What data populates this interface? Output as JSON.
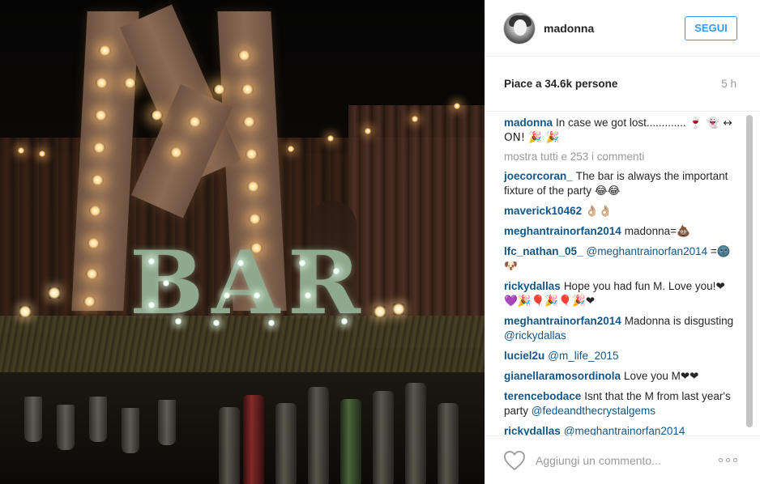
{
  "post": {
    "author": "madonna",
    "follow_label": "SEGUI",
    "likes_text": "Piace a 34.6k persone",
    "time_ago": "5 h",
    "caption": {
      "user": "madonna",
      "text": "In case we got lost.............",
      "emojis": "🍷 👻 ↔ ON! 🎉 🎉"
    },
    "show_all_comments": "mostra tutti e 253 i commenti",
    "comments": [
      {
        "user": "joecorcoran_",
        "pre": "The bar is always the important fixture of the party ",
        "mention": "",
        "post": "",
        "emoji": "😂😂"
      },
      {
        "user": "maverick10462",
        "pre": "",
        "mention": "",
        "post": "",
        "emoji": "👌🏼👌🏼"
      },
      {
        "user": "meghantrainorfan2014",
        "pre": "madonna=",
        "mention": "",
        "post": "",
        "emoji": "💩"
      },
      {
        "user": "lfc_nathan_05_",
        "pre": "",
        "mention": "@meghantrainorfan2014",
        "post": " =",
        "emoji": "🌚🐶"
      },
      {
        "user": "rickydallas",
        "pre": "Hope you had fun M. Love you!",
        "mention": "",
        "post": "",
        "emoji": "❤💜🎉🎈🎉🎈🎉❤"
      },
      {
        "user": "meghantrainorfan2014",
        "pre": "Madonna is disgusting ",
        "mention": "@rickydallas",
        "post": "",
        "emoji": ""
      },
      {
        "user": "luciel2u",
        "pre": "",
        "mention": "@m_life_2015",
        "post": "",
        "emoji": ""
      },
      {
        "user": "gianellaramosordinola",
        "pre": "Love you M",
        "mention": "",
        "post": "",
        "emoji": "❤❤"
      },
      {
        "user": "terencebodace",
        "pre": "Isnt that the M from last year's party ",
        "mention": "@fedeandthecrystalgems",
        "post": "",
        "emoji": ""
      },
      {
        "user": "rickydallas",
        "pre": "",
        "mention": "@meghantrainorfan2014",
        "post": "",
        "emoji": ""
      }
    ],
    "add_comment_placeholder": "Aggiungi un commento...",
    "icons": {
      "like": "heart-icon",
      "more": "more-options-icon"
    }
  },
  "colors": {
    "link": "#125688",
    "follow": "#3897f0",
    "muted": "#999999"
  }
}
